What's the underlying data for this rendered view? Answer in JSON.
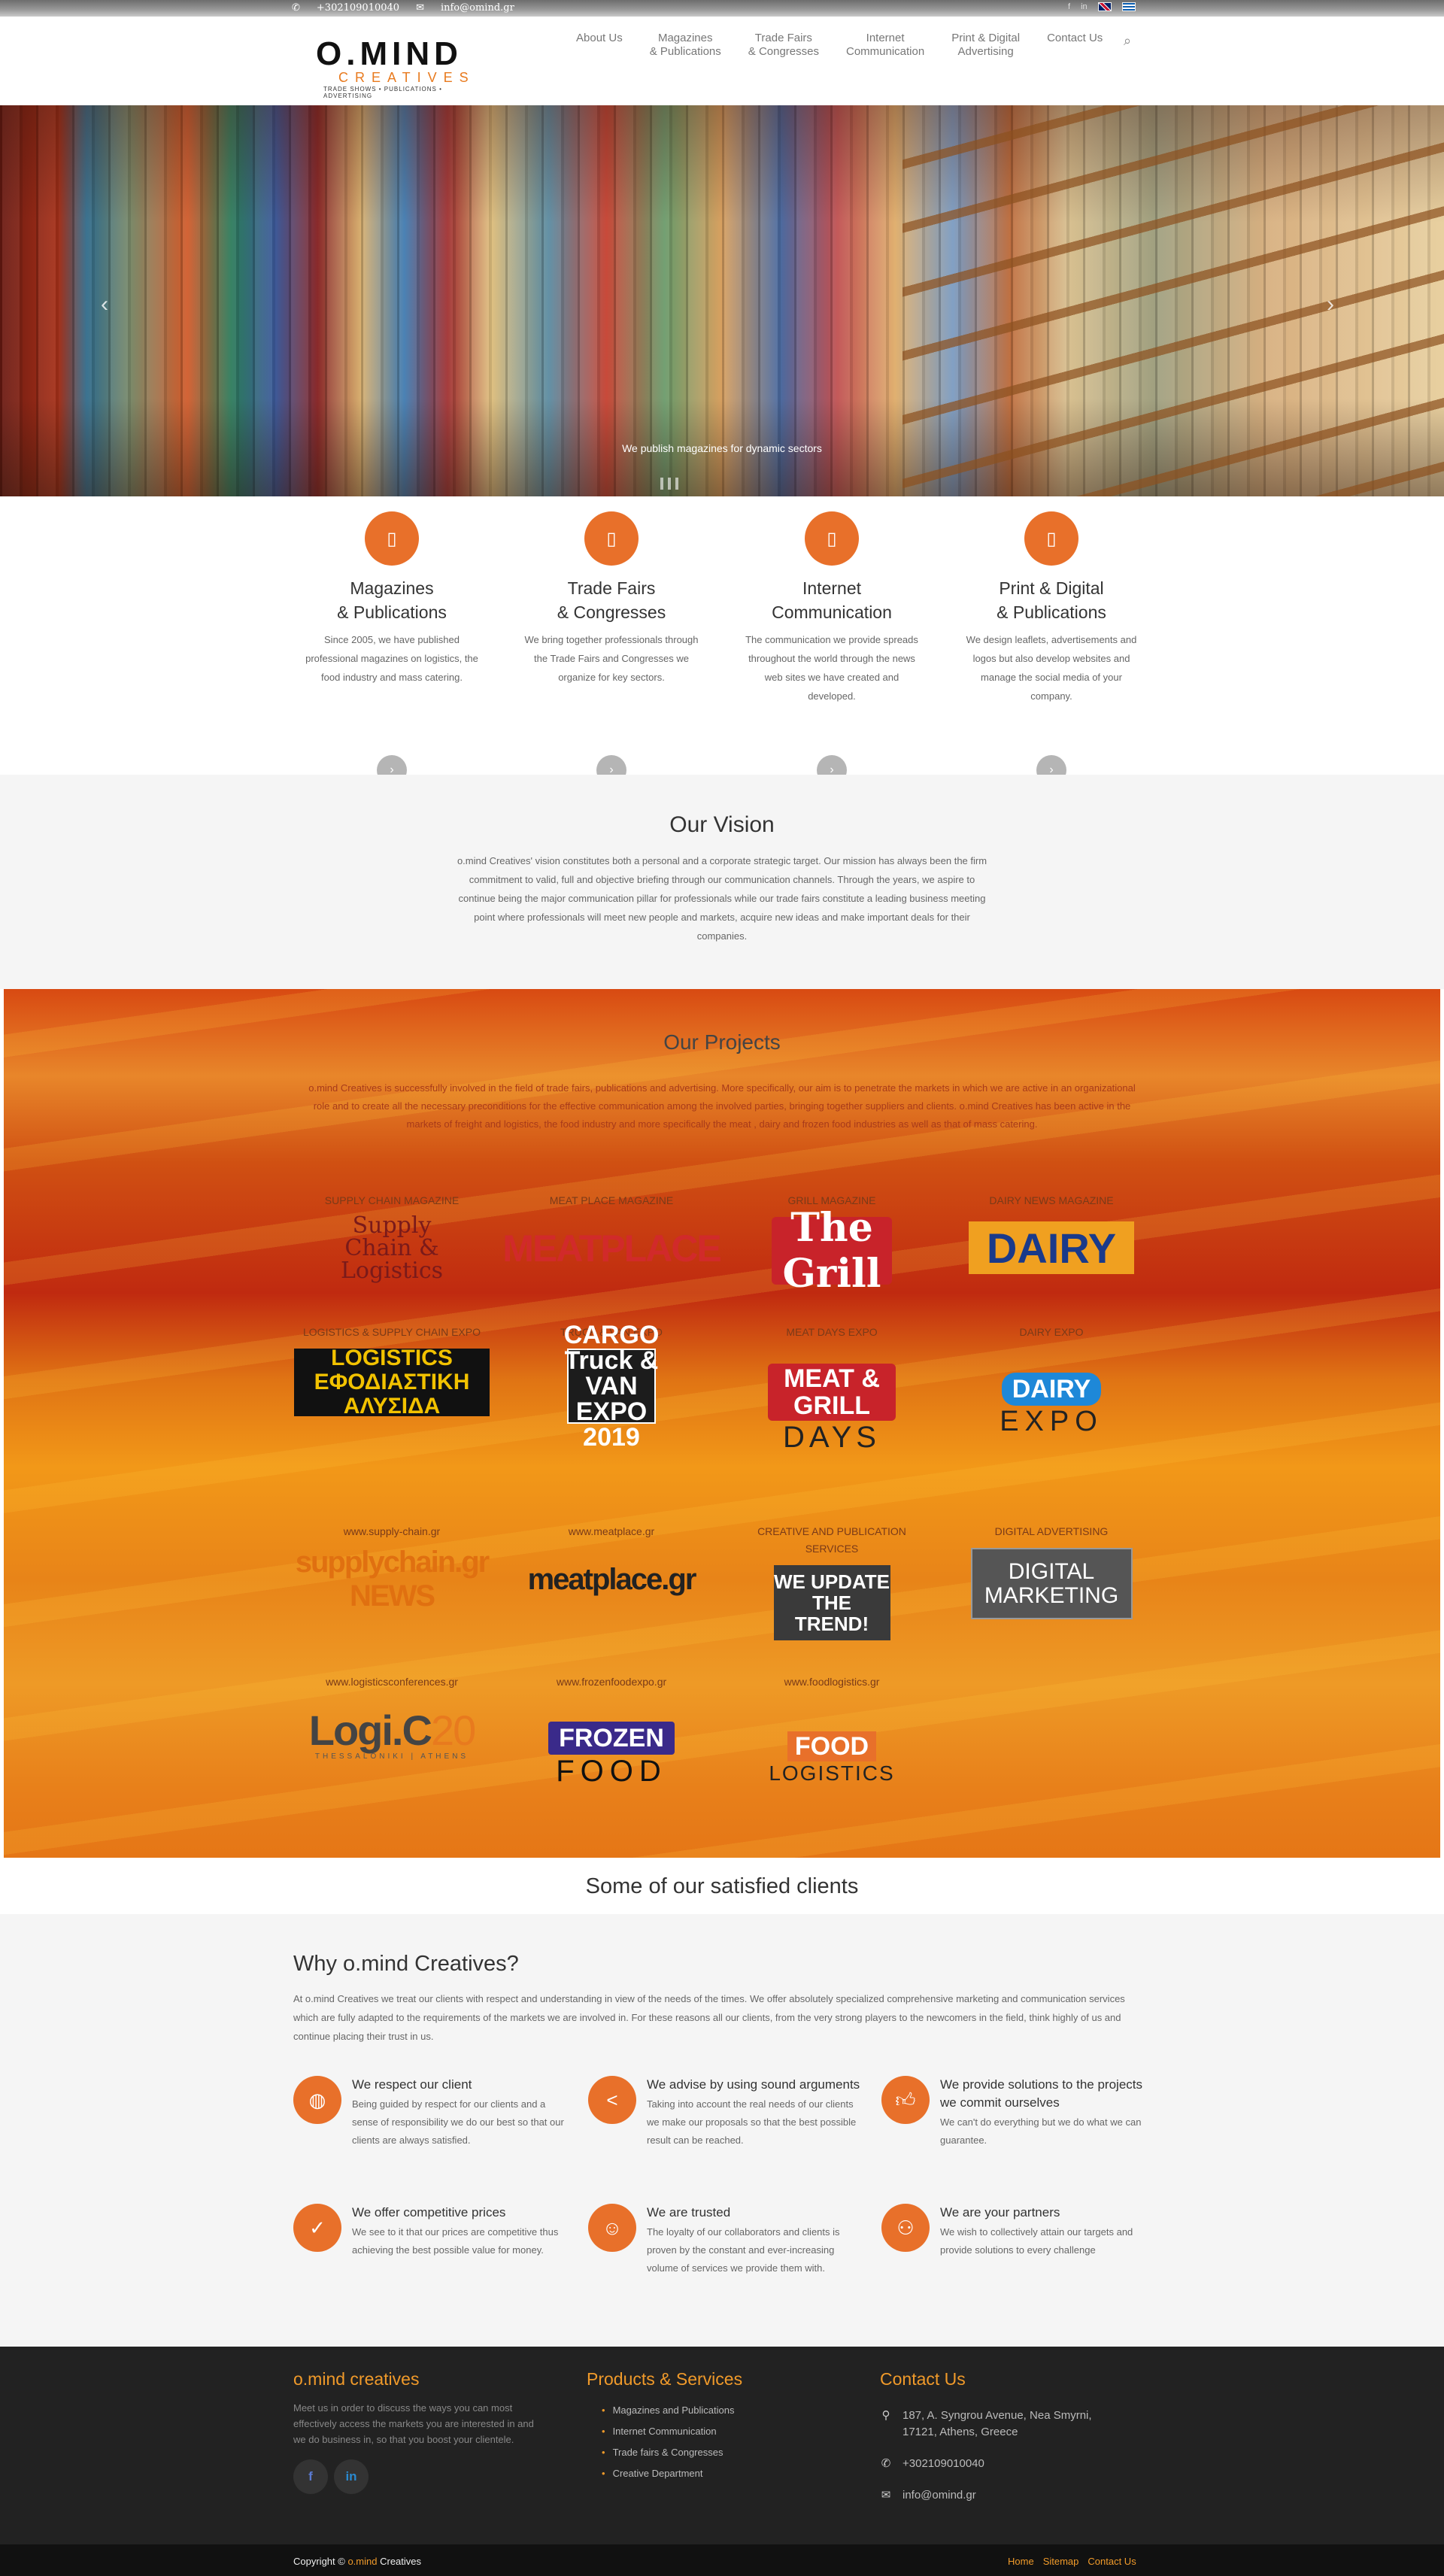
{
  "topbar": {
    "phone": "+302109010040",
    "email": "info@omind.gr",
    "languages": [
      "English",
      "Ελληνικά"
    ]
  },
  "header": {
    "logo_main": "O.MIND",
    "logo_sub": "CREATIVES",
    "logo_tagline": "TRADE SHOWS • PUBLICATIONS • ADVERTISING",
    "nav": [
      {
        "label": "About Us"
      },
      {
        "label": "Magazines\n& Publications"
      },
      {
        "label": "Trade Fairs\n& Congresses"
      },
      {
        "label": "Internet\nCommunication"
      },
      {
        "label": "Print & Digital\nAdvertising"
      },
      {
        "label": "Contact Us"
      }
    ]
  },
  "hero": {
    "caption": "We publish magazines for dynamic sectors"
  },
  "services": [
    {
      "icon": "book-icon",
      "title": "Magazines\n& Publications",
      "text": "Since 2005, we have published professional magazines on logistics, the food industry and mass catering."
    },
    {
      "icon": "book-icon",
      "title": "Trade Fairs\n& Congresses",
      "text": "We bring together professionals through the Trade Fairs and Congresses we organize for key sectors."
    },
    {
      "icon": "book-icon",
      "title": "Internet\nCommunication",
      "text": "The communication we provide spreads throughout the world through the news web sites we have created and developed."
    },
    {
      "icon": "book-icon",
      "title": "Print & Digital\n& Publications",
      "text": "We design leaflets, advertisements and logos but also develop websites and manage the social media of your company."
    }
  ],
  "vision": {
    "title": "Our Vision",
    "text": "o.mind Creatives' vision constitutes both a personal and a corporate strategic target. Our mission has always been the firm commitment to valid, full and objective briefing through our communication channels. Through the years, we aspire to continue being the major communication pillar for professionals while our trade fairs constitute a leading business meeting point where professionals will meet new people and markets, acquire new ideas and make important deals for their companies."
  },
  "projects": {
    "title": "Our Projects",
    "intro": "o.mind Creatives is successfully involved in the field of trade fairs, publications and advertising. More specifically, our aim is to penetrate the markets in which we are active in an organizational role and to create all the necessary preconditions for the effective communication among the involved parties, bringing together suppliers and clients. o.mind Creatives has been active in the markets of freight and logistics, the food industry and more specifically the meat , dairy and frozen food industries as well as that of mass catering.",
    "items": [
      {
        "label": "SUPPLY CHAIN MAGAZINE",
        "logo": "Supply Chain & Logistics"
      },
      {
        "label": "MEAT PLACE MAGAZINE",
        "logo": "MEATPLACE"
      },
      {
        "label": "GRILL MAGAZINE",
        "logo": "The Grill"
      },
      {
        "label": "DAIRY NEWS MAGAZINE",
        "logo": "DAIRY"
      },
      {
        "label": "LOGISTICS & SUPPLY CHAIN EXPO",
        "logo": "LOGISTICS ΕΦΟΔΙΑΣΤΙΚΗ ΑΛΥΣΙΔΑ"
      },
      {
        "label": "TRUCK & VAN EXPO",
        "logo": "CARGO Truck & VAN EXPO 2019"
      },
      {
        "label": "MEAT DAYS EXPO",
        "logo": "MEAT & GRILL DAYS"
      },
      {
        "label": "DAIRY EXPO",
        "logo": "DAIRY EXPO"
      },
      {
        "label": "www.supply-chain.gr",
        "logo": "supplychain.gr NEWS"
      },
      {
        "label": "www.meatplace.gr",
        "logo": "meatplace.gr"
      },
      {
        "label": "CREATIVE AND PUBLICATION SERVICES",
        "logo": "WE UPDATE THE TREND!"
      },
      {
        "label": "DIGITAL ADVERTISING",
        "logo": "DIGITAL MARKETING"
      },
      {
        "label": "www.logisticsconferences.gr",
        "logo": "Logi.C 20"
      },
      {
        "label": "www.frozenfoodexpo.gr",
        "logo": "FROZEN FOOD"
      },
      {
        "label": "www.foodlogistics.gr",
        "logo": "FOOD LOGISTICS"
      }
    ]
  },
  "clients": {
    "title": "Some of our satisfied clients"
  },
  "why": {
    "title": "Why o.mind Creatives?",
    "intro": "At o.mind Creatives we treat our clients with respect and understanding in view of the needs of the times. We offer absolutely specialized comprehensive marketing and communication services which are fully adapted to the requirements of the markets we are involved in. For these reasons all our clients, from the very strong players to the newcomers in the field, think highly of us and continue placing their trust in us.",
    "features": [
      {
        "icon": "globe-icon",
        "title": "We respect our client",
        "text": "Being guided by respect for our clients and a sense of responsibility we do our best so that our clients are always satisfied."
      },
      {
        "icon": "share-icon",
        "title": "We advise by using sound arguments",
        "text": "Taking into account the real needs of our clients we make our proposals so that the best possible result can be reached."
      },
      {
        "icon": "thumbs-up-icon",
        "title": "We provide solutions to the projects we commit ourselves",
        "text": "We can't do everything but we do what we can guarantee."
      },
      {
        "icon": "check-icon",
        "title": "We offer competitive prices",
        "text": "We see to it that our prices are competitive thus achieving the best possible value for money."
      },
      {
        "icon": "smile-icon",
        "title": "We are trusted",
        "text": "The loyalty of our collaborators and clients is proven by the constant and ever-increasing volume of services we provide them with."
      },
      {
        "icon": "people-icon",
        "title": "We are your partners",
        "text": "We wish to collectively attain our targets and provide solutions to every challenge"
      }
    ]
  },
  "footer": {
    "about_title": "o.mind creatives",
    "about_text": "Meet us in order to discuss the ways you can most effectively access the markets you are interested in and we do business in, so that you boost your clientele.",
    "social": [
      "f",
      "in"
    ],
    "products_title": "Products & Services",
    "products": [
      "Magazines and Publications",
      "Internet Communication",
      "Trade fairs & Congresses",
      "Creative Department"
    ],
    "contact_title": "Contact Us",
    "address": "187, A. Syngrou Avenue, Nea Smyrni, 17121, Athens, Greece",
    "phone": "+302109010040",
    "email": "info@omind.gr"
  },
  "copyright": {
    "prefix": "Copyright ©",
    "brand": "o.mind",
    "suffix": "Creatives",
    "links": [
      "Home",
      "Sitemap",
      "Contact Us"
    ]
  },
  "colors": {
    "accent": "#e8702a",
    "footer_heading": "#f09a2a",
    "footer_bg": "#222222"
  }
}
